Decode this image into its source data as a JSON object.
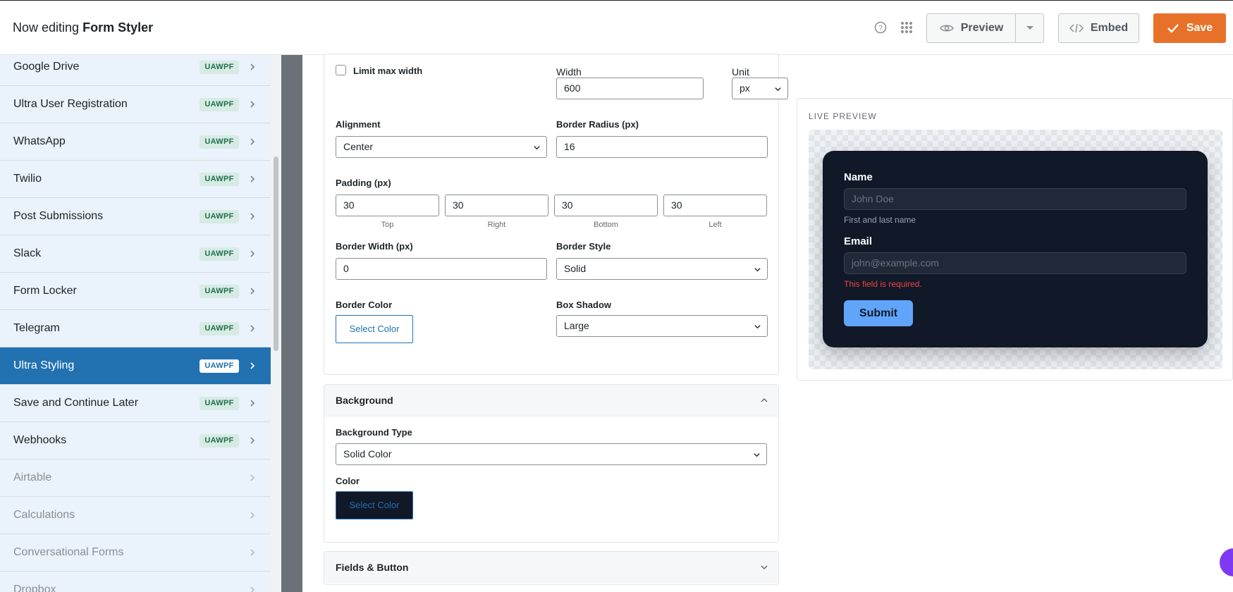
{
  "header": {
    "title_prefix": "Now editing",
    "title_form": "Form Styler",
    "icons": [
      "help-icon",
      "grid-icon"
    ],
    "preview_label": "Preview",
    "embed_label": "Embed",
    "save_label": "Save",
    "save_color": "#e8712a"
  },
  "sidebar": {
    "badge": "UAWPF",
    "items": [
      {
        "label": "Google Drive",
        "state": "normal"
      },
      {
        "label": "Ultra User Registration",
        "state": "normal"
      },
      {
        "label": "WhatsApp",
        "state": "normal"
      },
      {
        "label": "Twilio",
        "state": "normal"
      },
      {
        "label": "Post Submissions",
        "state": "normal"
      },
      {
        "label": "Slack",
        "state": "normal"
      },
      {
        "label": "Form Locker",
        "state": "normal"
      },
      {
        "label": "Telegram",
        "state": "normal"
      },
      {
        "label": "Ultra Styling",
        "state": "active"
      },
      {
        "label": "Save and Continue Later",
        "state": "normal"
      },
      {
        "label": "Webhooks",
        "state": "normal"
      },
      {
        "label": "Airtable",
        "state": "disabled"
      },
      {
        "label": "Calculations",
        "state": "disabled"
      },
      {
        "label": "Conversational Forms",
        "state": "disabled"
      },
      {
        "label": "Dropbox",
        "state": "disabled"
      }
    ],
    "active_color": "#2271b1"
  },
  "container": {
    "limit_max_width_label": "Limit max width",
    "limit_max_width_checked": false,
    "width_label": "Width",
    "width_value": "600",
    "unit_label": "Unit",
    "unit_value": "px",
    "alignment_label": "Alignment",
    "alignment_value": "Center",
    "border_radius_label": "Border Radius (px)",
    "border_radius_value": "16",
    "padding_label": "Padding (px)",
    "padding": [
      {
        "value": "30",
        "side": "Top"
      },
      {
        "value": "30",
        "side": "Right"
      },
      {
        "value": "30",
        "side": "Bottom"
      },
      {
        "value": "30",
        "side": "Left"
      }
    ],
    "border_width_label": "Border Width (px)",
    "border_width_value": "0",
    "border_style_label": "Border Style",
    "border_style_value": "Solid",
    "border_color_label": "Border Color",
    "border_color_button": "Select Color",
    "box_shadow_label": "Box Shadow",
    "box_shadow_value": "Large"
  },
  "background": {
    "section_title": "Background",
    "type_label": "Background Type",
    "type_value": "Solid Color",
    "color_label": "Color",
    "color_button": "Select Color",
    "color_value": "#111827"
  },
  "fields_section": {
    "section_title": "Fields & Button"
  },
  "preview": {
    "title": "LIVE PREVIEW",
    "name_label": "Name",
    "name_placeholder": "John Doe",
    "name_help": "First and last name",
    "email_label": "Email",
    "email_placeholder": "john@example.com",
    "email_error": "This field is required.",
    "submit_label": "Submit",
    "submit_color": "#60a5fa"
  }
}
